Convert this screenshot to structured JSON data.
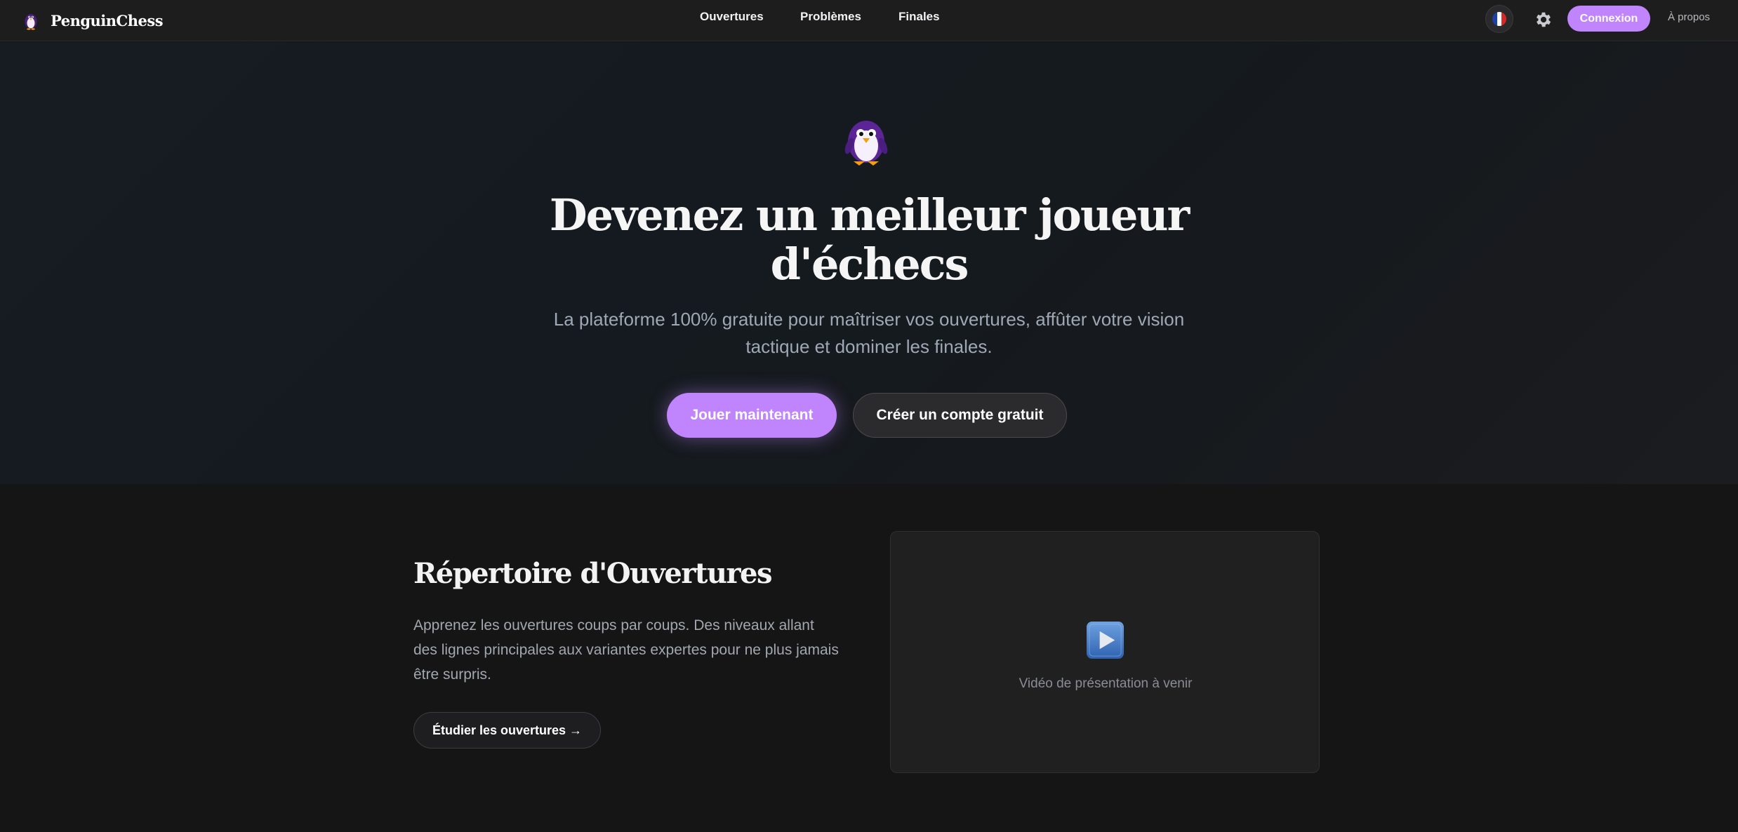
{
  "brand": {
    "name": "PenguinChess",
    "accent": "#c084fc"
  },
  "nav": {
    "links": [
      {
        "label": "Ouvertures"
      },
      {
        "label": "Problèmes"
      },
      {
        "label": "Finales"
      }
    ],
    "language_icon": "french-flag-icon",
    "settings_icon": "gear-icon",
    "login_label": "Connexion",
    "about_label": "À propos"
  },
  "hero": {
    "mascot_icon": "penguin-icon",
    "title": "Devenez un meilleur joueur d'échecs",
    "subtitle": "La plateforme 100% gratuite pour maîtriser vos ouvertures, affûter votre vision tactique et dominer les finales.",
    "primary_cta": "Jouer maintenant",
    "secondary_cta": "Créer un compte gratuit"
  },
  "feature": {
    "title": "Répertoire d'Ouvertures",
    "description": "Apprenez les ouvertures coups par coups. Des niveaux allant des lignes principales aux variantes expertes pour ne plus jamais être surpris.",
    "cta": "Étudier les ouvertures →",
    "video": {
      "icon": "play-button-icon",
      "caption": "Vidéo de présentation à venir"
    }
  }
}
